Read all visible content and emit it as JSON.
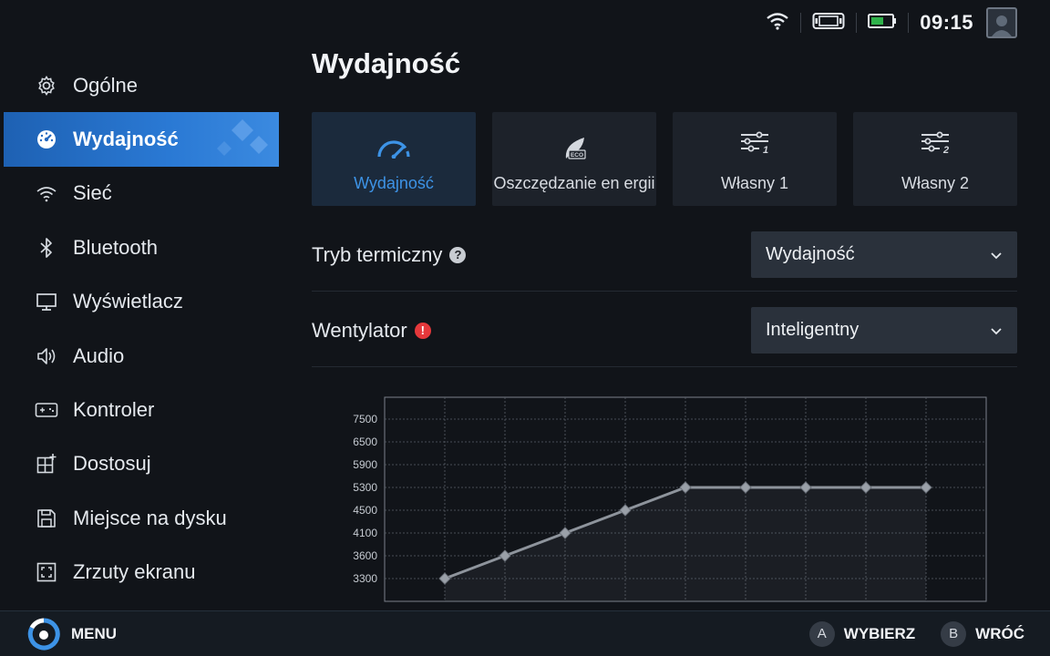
{
  "status": {
    "time": "09:15",
    "icons": [
      "wifi-icon",
      "handheld-icon",
      "battery-icon"
    ],
    "battery_color": "#2fb24a"
  },
  "sidebar": {
    "items": [
      {
        "label": "Ogólne",
        "icon": "gear-icon"
      },
      {
        "label": "Wydajność",
        "icon": "performance-icon",
        "active": true
      },
      {
        "label": "Sieć",
        "icon": "wifi-icon"
      },
      {
        "label": "Bluetooth",
        "icon": "bluetooth-icon"
      },
      {
        "label": "Wyświetlacz",
        "icon": "monitor-icon"
      },
      {
        "label": "Audio",
        "icon": "speaker-icon"
      },
      {
        "label": "Kontroler",
        "icon": "gamepad-icon"
      },
      {
        "label": "Dostosuj",
        "icon": "customize-icon"
      },
      {
        "label": "Miejsce na dysku",
        "icon": "floppy-icon"
      },
      {
        "label": "Zrzuty ekranu",
        "icon": "screenshot-icon"
      }
    ]
  },
  "main": {
    "title": "Wydajność",
    "modes": [
      {
        "label": "Wydajność",
        "icon": "speedometer-icon",
        "active": true
      },
      {
        "label": "Oszczędzanie en ergii",
        "icon": "eco-leaf-icon"
      },
      {
        "label": "Własny 1",
        "icon": "sliders-1-icon"
      },
      {
        "label": "Własny 2",
        "icon": "sliders-2-icon"
      }
    ],
    "thermal": {
      "label": "Tryb termiczny",
      "value": "Wydajność",
      "badge": "?"
    },
    "fan": {
      "label": "Wentylator",
      "value": "Inteligentny",
      "badge": "!"
    }
  },
  "chart_data": {
    "type": "line",
    "title": "",
    "xlabel": "",
    "ylabel": "",
    "y_ticks": [
      3300,
      3600,
      4100,
      4500,
      5300,
      5900,
      6500,
      7500
    ],
    "x": [
      1,
      2,
      3,
      4,
      5,
      6,
      7,
      8,
      9
    ],
    "series": [
      {
        "values": [
          3300,
          3600,
          4100,
          4500,
          5300,
          5300,
          5300,
          5300,
          5300
        ]
      }
    ],
    "grid": true,
    "colors": {
      "line": "#8e949c",
      "point": "#9aa0a8"
    }
  },
  "bottombar": {
    "menu": "MENU",
    "select_key": "A",
    "select_label": "WYBIERZ",
    "back_key": "B",
    "back_label": "WRÓĆ"
  },
  "colors": {
    "accent": "#2a79d4",
    "active_mode_text": "#3d93e6",
    "fan_badge": "#e5383b",
    "thermal_badge": "#c8ccd2"
  }
}
